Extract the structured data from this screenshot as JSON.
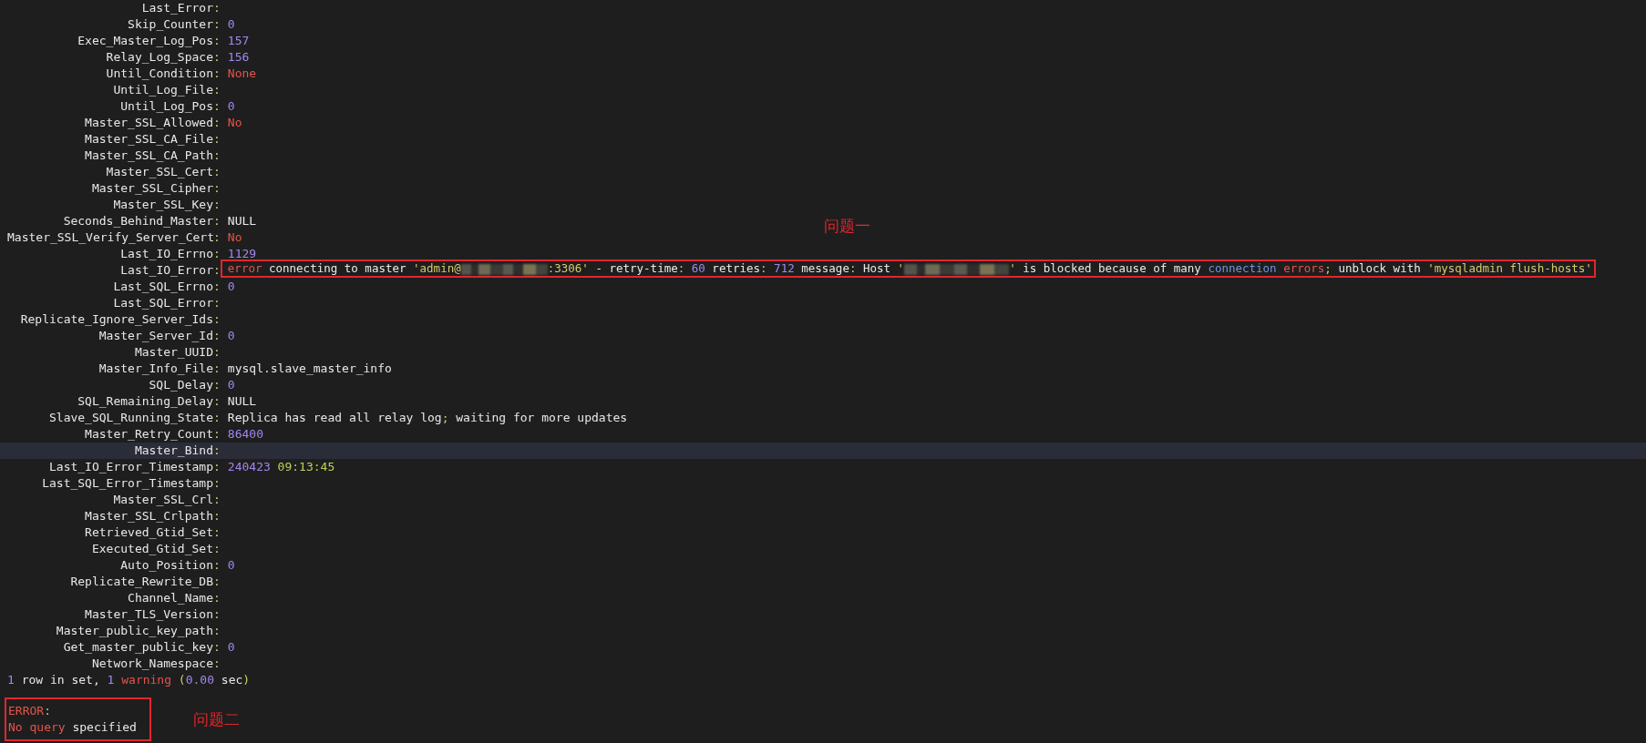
{
  "rows": [
    {
      "key": "Last_Error",
      "colon": ":",
      "highlighted": false
    },
    {
      "key": "Skip_Counter",
      "colon": ":",
      "highlighted": false,
      "value": [
        {
          "text": "0",
          "kind": "number"
        }
      ]
    },
    {
      "key": "Exec_Master_Log_Pos",
      "colon": ":",
      "highlighted": false,
      "value": [
        {
          "text": "157",
          "kind": "number"
        }
      ]
    },
    {
      "key": "Relay_Log_Space",
      "colon": ":",
      "highlighted": false,
      "value": [
        {
          "text": "156",
          "kind": "number"
        }
      ]
    },
    {
      "key": "Until_Condition",
      "colon": ":",
      "highlighted": false,
      "value": [
        {
          "text": "None",
          "kind": "keyword"
        }
      ]
    },
    {
      "key": "Until_Log_File",
      "colon": ":",
      "highlighted": false
    },
    {
      "key": "Until_Log_Pos",
      "colon": ":",
      "highlighted": false,
      "value": [
        {
          "text": "0",
          "kind": "number"
        }
      ]
    },
    {
      "key": "Master_SSL_Allowed",
      "colon": ":",
      "highlighted": false,
      "value": [
        {
          "text": "No",
          "kind": "keyword"
        }
      ]
    },
    {
      "key": "Master_SSL_CA_File",
      "colon": ":",
      "highlighted": false
    },
    {
      "key": "Master_SSL_CA_Path",
      "colon": ":",
      "highlighted": false
    },
    {
      "key": "Master_SSL_Cert",
      "colon": ":",
      "highlighted": false
    },
    {
      "key": "Master_SSL_Cipher",
      "colon": ":",
      "highlighted": false
    },
    {
      "key": "Master_SSL_Key",
      "colon": ":",
      "highlighted": false
    },
    {
      "key": "Seconds_Behind_Master",
      "colon": ":",
      "highlighted": false,
      "value": [
        {
          "text": "NULL",
          "kind": "text"
        }
      ]
    },
    {
      "key": "Master_SSL_Verify_Server_Cert",
      "colon": ":",
      "highlighted": false,
      "value": [
        {
          "text": "No",
          "kind": "keyword"
        }
      ]
    },
    {
      "key": "Last_IO_Errno",
      "colon": ":",
      "highlighted": false,
      "value": [
        {
          "text": "1129",
          "kind": "number"
        }
      ]
    },
    {
      "key": "Last_IO_Error",
      "colon": ":",
      "highlighted": false,
      "annotation": "问题一",
      "value": [
        {
          "text": "error",
          "kind": "keyword"
        },
        {
          "text": " connecting to master ",
          "kind": "text"
        },
        {
          "text": "'admin@",
          "kind": "string"
        },
        {
          "kind": "redacted"
        },
        {
          "text": ":3306'",
          "kind": "string"
        },
        {
          "text": " - retry-time",
          "kind": "text"
        },
        {
          "text": ":",
          "kind": "punct"
        },
        {
          "text": " 60",
          "kind": "number"
        },
        {
          "text": " retries",
          "kind": "text"
        },
        {
          "text": ":",
          "kind": "punct"
        },
        {
          "text": " 712",
          "kind": "number"
        },
        {
          "text": " message",
          "kind": "text"
        },
        {
          "text": ":",
          "kind": "punct"
        },
        {
          "text": " Host ",
          "kind": "text"
        },
        {
          "text": "'",
          "kind": "string"
        },
        {
          "kind": "redacted"
        },
        {
          "text": "'",
          "kind": "string"
        },
        {
          "text": " is blocked because of many ",
          "kind": "text"
        },
        {
          "text": "connection ",
          "kind": "link"
        },
        {
          "text": "errors",
          "kind": "keyword"
        },
        {
          "text": ";",
          "kind": "punct"
        },
        {
          "text": " unblock with ",
          "kind": "text"
        },
        {
          "text": "'mysqladmin flush-hosts'",
          "kind": "string"
        }
      ]
    },
    {
      "key": "Last_SQL_Errno",
      "colon": ":",
      "highlighted": false,
      "value": [
        {
          "text": "0",
          "kind": "number"
        }
      ]
    },
    {
      "key": "Last_SQL_Error",
      "colon": ":",
      "highlighted": false
    },
    {
      "key": "Replicate_Ignore_Server_Ids",
      "colon": ":",
      "highlighted": false
    },
    {
      "key": "Master_Server_Id",
      "colon": ":",
      "highlighted": false,
      "value": [
        {
          "text": "0",
          "kind": "number"
        }
      ]
    },
    {
      "key": "Master_UUID",
      "colon": ":",
      "highlighted": false
    },
    {
      "key": "Master_Info_File",
      "colon": ":",
      "highlighted": false,
      "value": [
        {
          "text": "mysql.slave_master_info",
          "kind": "text"
        }
      ]
    },
    {
      "key": "SQL_Delay",
      "colon": ":",
      "highlighted": false,
      "value": [
        {
          "text": "0",
          "kind": "number"
        }
      ]
    },
    {
      "key": "SQL_Remaining_Delay",
      "colon": ":",
      "highlighted": false,
      "value": [
        {
          "text": "NULL",
          "kind": "text"
        }
      ]
    },
    {
      "key": "Slave_SQL_Running_State",
      "colon": ":",
      "highlighted": false,
      "value": [
        {
          "text": "Replica has read all relay log",
          "kind": "text"
        },
        {
          "text": ";",
          "kind": "punct"
        },
        {
          "text": " waiting for more updates",
          "kind": "text"
        }
      ]
    },
    {
      "key": "Master_Retry_Count",
      "colon": ":",
      "highlighted": false,
      "value": [
        {
          "text": "86400",
          "kind": "number"
        }
      ]
    },
    {
      "key": "Master_Bind",
      "colon": ":",
      "highlighted": true
    },
    {
      "key": "Last_IO_Error_Timestamp",
      "colon": ":",
      "highlighted": false,
      "value": [
        {
          "text": "240423",
          "kind": "number"
        },
        {
          "text": " 09:13:45",
          "kind": "time"
        }
      ]
    },
    {
      "key": "Last_SQL_Error_Timestamp",
      "colon": ":",
      "highlighted": false
    },
    {
      "key": "Master_SSL_Crl",
      "colon": ":",
      "highlighted": false
    },
    {
      "key": "Master_SSL_Crlpath",
      "colon": ":",
      "highlighted": false
    },
    {
      "key": "Retrieved_Gtid_Set",
      "colon": ":",
      "highlighted": false
    },
    {
      "key": "Executed_Gtid_Set",
      "colon": ":",
      "highlighted": false
    },
    {
      "key": "Auto_Position",
      "colon": ":",
      "highlighted": false,
      "value": [
        {
          "text": "0",
          "kind": "number"
        }
      ]
    },
    {
      "key": "Replicate_Rewrite_DB",
      "colon": ":",
      "highlighted": false
    },
    {
      "key": "Channel_Name",
      "colon": ":",
      "highlighted": false
    },
    {
      "key": "Master_TLS_Version",
      "colon": ":",
      "highlighted": false
    },
    {
      "key": "Master_public_key_path",
      "colon": ":",
      "highlighted": false
    },
    {
      "key": "Get_master_public_key",
      "colon": ":",
      "highlighted": false,
      "value": [
        {
          "text": "0",
          "kind": "number"
        }
      ]
    },
    {
      "key": "Network_Namespace",
      "colon": ":",
      "highlighted": false
    }
  ],
  "result_line": [
    {
      "text": "1",
      "kind": "number"
    },
    {
      "text": " row in set, ",
      "kind": "text"
    },
    {
      "text": "1",
      "kind": "number"
    },
    {
      "text": " warning",
      "kind": "keyword"
    },
    {
      "text": " (",
      "kind": "punct"
    },
    {
      "text": "0.00",
      "kind": "number"
    },
    {
      "text": " sec",
      "kind": "text"
    },
    {
      "text": ")",
      "kind": "punct"
    }
  ],
  "error_block": {
    "annotation": "问题二",
    "lines": [
      [
        {
          "text": "ERROR",
          "kind": "keyword"
        },
        {
          "text": ":",
          "kind": "punct"
        }
      ],
      [
        {
          "text": "No query",
          "kind": "keyword"
        },
        {
          "text": " specified",
          "kind": "text"
        }
      ]
    ]
  }
}
